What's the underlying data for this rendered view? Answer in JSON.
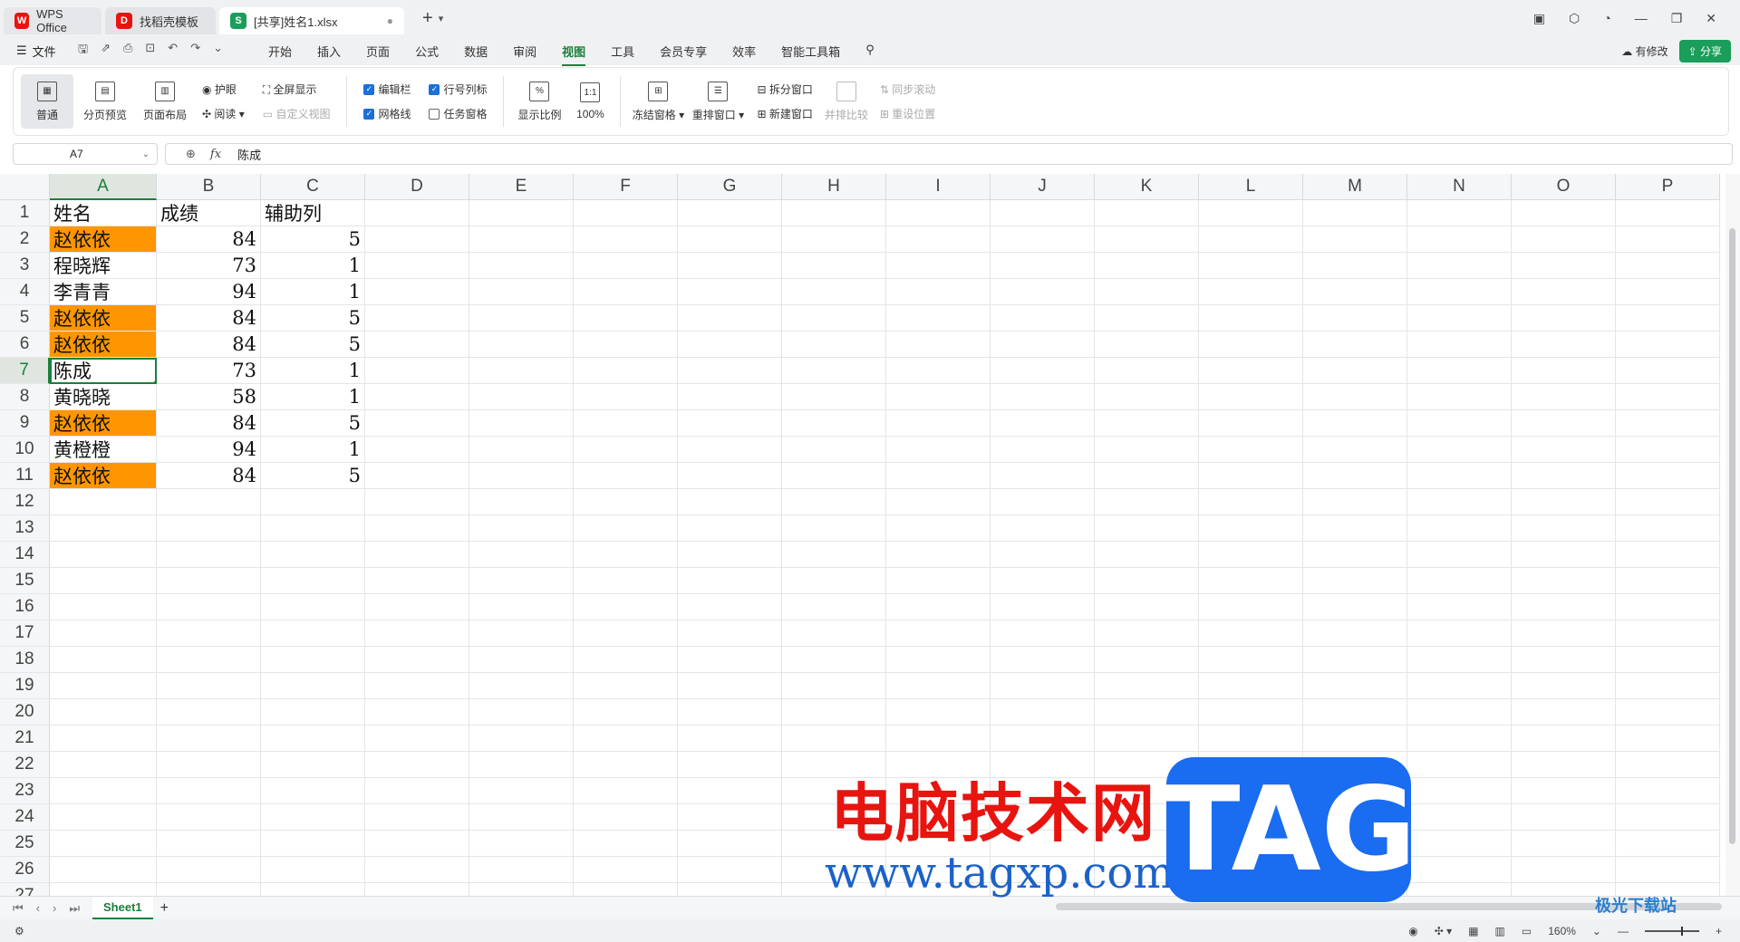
{
  "tabs": [
    {
      "label": "WPS Office",
      "icon": "wps-logo-icon",
      "color": "#e8140f"
    },
    {
      "label": "找稻壳模板",
      "icon": "docer-logo-icon",
      "color": "#e8140f"
    },
    {
      "label": "[共享]姓名1.xlsx",
      "icon": "spreadsheet-logo-icon",
      "color": "#1a9e5a"
    }
  ],
  "menubar": {
    "file_label": "文件",
    "items": [
      "开始",
      "插入",
      "页面",
      "公式",
      "数据",
      "审阅",
      "视图",
      "工具",
      "会员专享",
      "效率",
      "智能工具箱"
    ],
    "active": "视图",
    "modified_label": "有修改",
    "share_label": "分享"
  },
  "ribbon": {
    "normal": "普通",
    "page_break": "分页预览",
    "page_layout": "页面布局",
    "eye_protect": "护眼",
    "reading": "阅读",
    "fullscreen": "全屏显示",
    "custom_view": "自定义视图",
    "edit_bar": "编辑栏",
    "row_col_header": "行号列标",
    "gridlines": "网格线",
    "task_pane": "任务窗格",
    "zoom_ratio": "显示比例",
    "zoom_100": "100%",
    "freeze": "冻结窗格",
    "rearrange": "重排窗口",
    "split": "拆分窗口",
    "new_window": "新建窗口",
    "side_by_side": "并排比较",
    "sync_scroll": "同步滚动",
    "reset_position": "重设位置"
  },
  "formula_bar": {
    "cell_ref": "A7",
    "fx": "fx",
    "value": "陈成"
  },
  "columns": [
    "A",
    "B",
    "C",
    "D",
    "E",
    "F",
    "G",
    "H",
    "I",
    "J",
    "K",
    "L",
    "M",
    "N",
    "O",
    "P"
  ],
  "rows": [
    "1",
    "2",
    "3",
    "4",
    "5",
    "6",
    "7",
    "8",
    "9",
    "10",
    "11",
    "12",
    "13",
    "14",
    "15",
    "16",
    "17",
    "18",
    "19",
    "20",
    "21",
    "22",
    "23",
    "24",
    "25",
    "26",
    "27"
  ],
  "table": {
    "headers": [
      "姓名",
      "成绩",
      "辅助列"
    ],
    "data": [
      {
        "name": "赵依依",
        "score": "84",
        "aux": "5",
        "highlight": true
      },
      {
        "name": "程晓辉",
        "score": "73",
        "aux": "1",
        "highlight": false
      },
      {
        "name": "李青青",
        "score": "94",
        "aux": "1",
        "highlight": false
      },
      {
        "name": "赵依依",
        "score": "84",
        "aux": "5",
        "highlight": true
      },
      {
        "name": "赵依依",
        "score": "84",
        "aux": "5",
        "highlight": true
      },
      {
        "name": "陈成",
        "score": "73",
        "aux": "1",
        "highlight": false
      },
      {
        "name": "黄晓晓",
        "score": "58",
        "aux": "1",
        "highlight": false
      },
      {
        "name": "赵依依",
        "score": "84",
        "aux": "5",
        "highlight": true
      },
      {
        "name": "黄橙橙",
        "score": "94",
        "aux": "1",
        "highlight": false
      },
      {
        "name": "赵依依",
        "score": "84",
        "aux": "5",
        "highlight": true
      }
    ],
    "highlight_color": "#ff9600",
    "active_cell": "A7"
  },
  "sheets": [
    "Sheet1"
  ],
  "statusbar": {
    "zoom": "160%"
  },
  "watermark": {
    "text": "电脑技术网",
    "url": "www.tagxp.com",
    "tag": "TAG",
    "site": "极光下载站"
  },
  "colors": {
    "accent": "#1a7f3c",
    "share": "#1a9e5a",
    "checkbox": "#1a6fd8"
  }
}
